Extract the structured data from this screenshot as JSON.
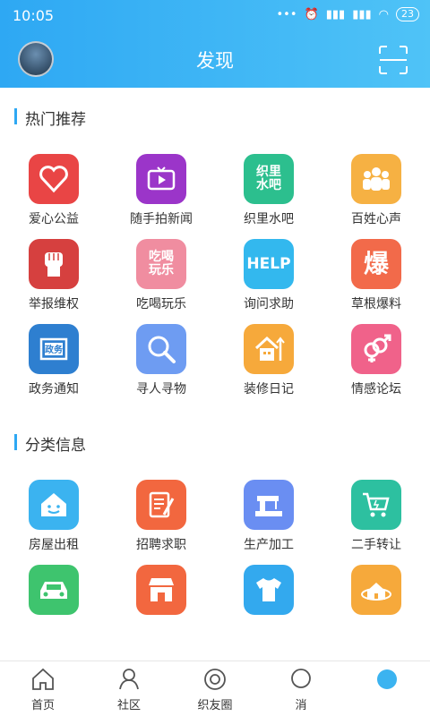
{
  "status": {
    "time": "10:05",
    "dots": "•••",
    "battery": "23"
  },
  "header": {
    "title": "发现"
  },
  "sections": [
    {
      "title": "热门推荐",
      "items": [
        {
          "label": "爱心公益",
          "color": "#e94545",
          "icon": "heart-icon"
        },
        {
          "label": "随手拍新闻",
          "color": "#9b35c9",
          "icon": "tv-icon"
        },
        {
          "label": "织里水吧",
          "color": "#2cbf8e",
          "icon": "text-logo-icon",
          "glyph": "织里\n水吧"
        },
        {
          "label": "百姓心声",
          "color": "#f6b143",
          "icon": "people-icon"
        },
        {
          "label": "举报维权",
          "color": "#d6403f",
          "icon": "fist-icon"
        },
        {
          "label": "吃喝玩乐",
          "color": "#f08da0",
          "icon": "text-logo-icon",
          "glyph": "吃喝\n玩乐"
        },
        {
          "label": "询问求助",
          "color": "#33b8ee",
          "icon": "help-icon",
          "glyph": "HELP"
        },
        {
          "label": "草根爆料",
          "color": "#f26a4a",
          "icon": "text-logo-icon",
          "glyph": "爆"
        },
        {
          "label": "政务通知",
          "color": "#2e7fd0",
          "icon": "government-icon"
        },
        {
          "label": "寻人寻物",
          "color": "#6e9cf2",
          "icon": "magnifier-icon"
        },
        {
          "label": "装修日记",
          "color": "#f6a93b",
          "icon": "house-growth-icon"
        },
        {
          "label": "情感论坛",
          "color": "#f0628a",
          "icon": "gender-icon"
        }
      ]
    },
    {
      "title": "分类信息",
      "items": [
        {
          "label": "房屋出租",
          "color": "#3bb3f0",
          "icon": "house-smile-icon"
        },
        {
          "label": "招聘求职",
          "color": "#f2673f",
          "icon": "document-pen-icon"
        },
        {
          "label": "生产加工",
          "color": "#6a8ef2",
          "icon": "sewing-machine-icon"
        },
        {
          "label": "二手转让",
          "color": "#2dc0a0",
          "icon": "cart-icon"
        },
        {
          "label": "",
          "color": "#3ec46e",
          "icon": "car-icon"
        },
        {
          "label": "",
          "color": "#f2673f",
          "icon": "shop-icon"
        },
        {
          "label": "",
          "color": "#33a9ee",
          "icon": "shirt-icon"
        },
        {
          "label": "",
          "color": "#f6a93b",
          "icon": "house-orbit-icon"
        }
      ]
    }
  ],
  "tabs": [
    {
      "label": "首页",
      "icon": "home-icon"
    },
    {
      "label": "社区",
      "icon": "community-icon"
    },
    {
      "label": "织友圈",
      "icon": "circle-icon"
    },
    {
      "label": "消",
      "icon": "message-icon"
    },
    {
      "label": "",
      "icon": "profile-icon"
    }
  ]
}
